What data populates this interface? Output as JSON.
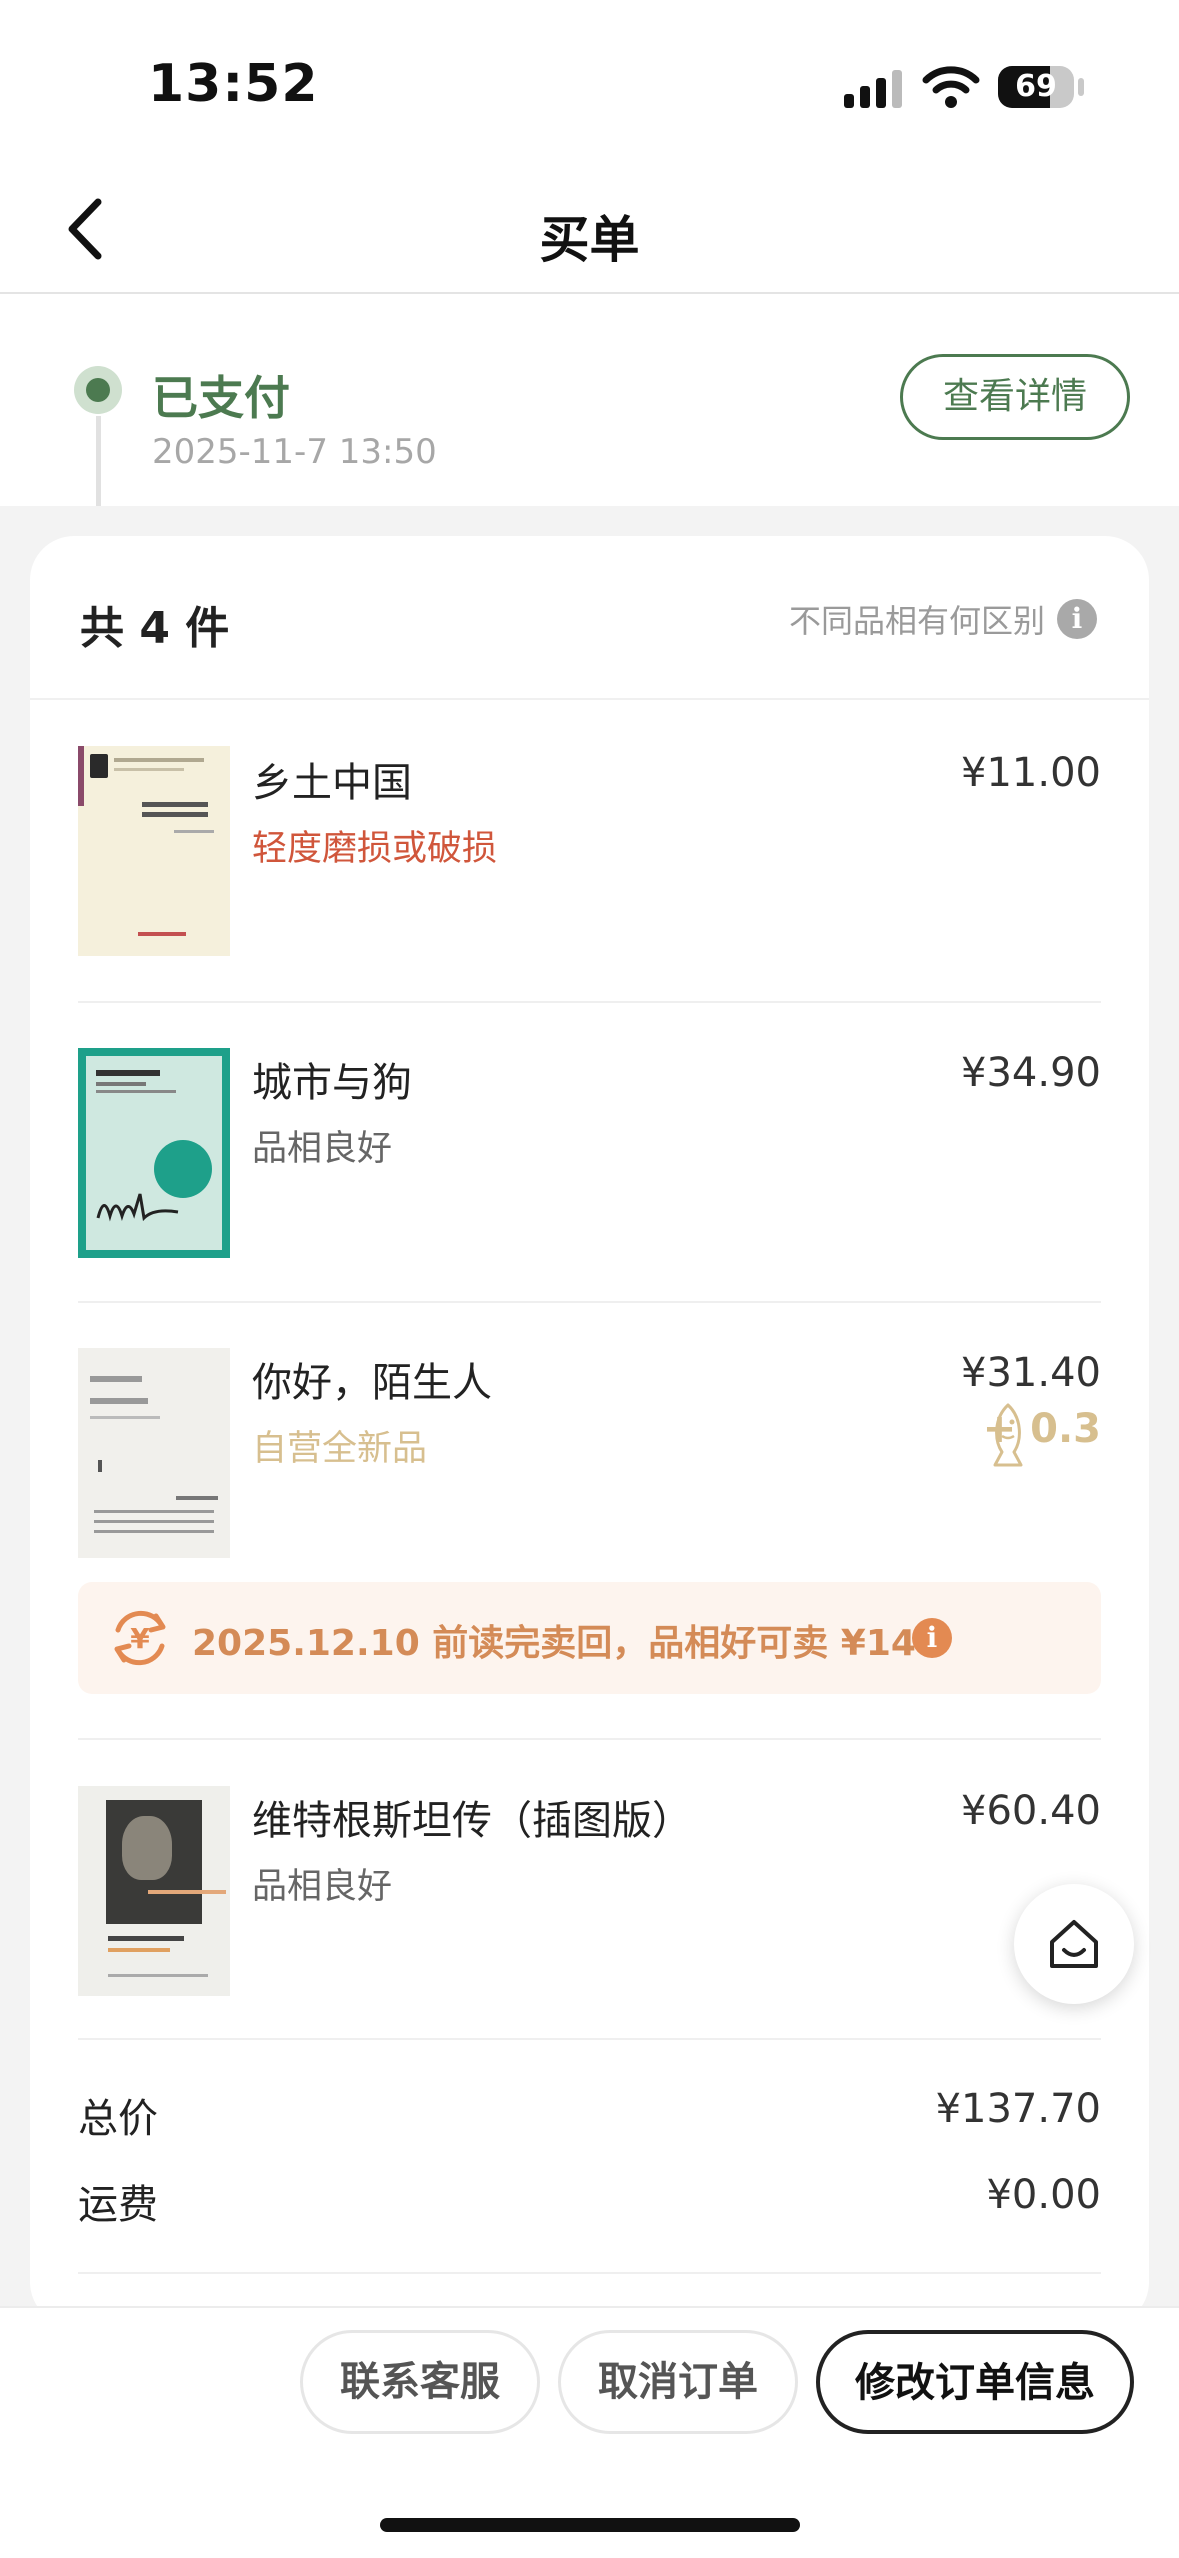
{
  "status_bar": {
    "time": "13:52",
    "battery": "69"
  },
  "nav": {
    "title": "买单"
  },
  "order_status": {
    "label": "已支付",
    "time": "2025-11-7 13:50",
    "detail_button": "查看详情"
  },
  "summary": {
    "count_label": "共 4 件",
    "condition_help": "不同品相有何区别"
  },
  "items": [
    {
      "title": "乡土中国",
      "condition": "轻度磨损或破损",
      "condition_color": "#d0563b",
      "price": "¥11.00"
    },
    {
      "title": "城市与狗",
      "condition": "品相良好",
      "condition_color": "#666666",
      "price": "¥34.90"
    },
    {
      "title": "你好，陌生人",
      "condition": "自营全新品",
      "condition_color": "#d7bf8f",
      "price": "¥31.40",
      "bonus": "+ 0.3"
    },
    {
      "title": "维特根斯坦传（插图版）",
      "condition": "品相良好",
      "condition_color": "#666666",
      "price": "¥60.40"
    }
  ],
  "sellback": {
    "text": "2025.12.10 前读完卖回，品相好可卖 ¥14"
  },
  "totals": {
    "total_label": "总价",
    "total_value": "¥137.70",
    "shipping_label": "运费",
    "shipping_value": "¥0.00"
  },
  "actions": {
    "contact": "联系客服",
    "cancel": "取消订单",
    "modify": "修改订单信息"
  },
  "colors": {
    "accent_green": "#4c7a50",
    "warning_red": "#d0563b",
    "orange": "#d48b57",
    "gold": "#d7bf8f"
  }
}
